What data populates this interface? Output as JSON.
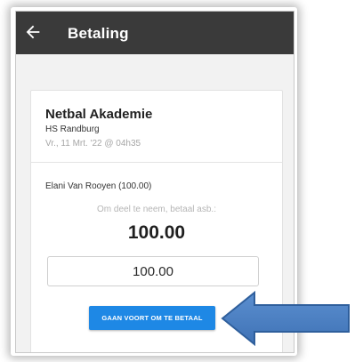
{
  "appbar": {
    "title": "Betaling",
    "back_icon": "arrow-left-icon",
    "background": "#3a3a3a"
  },
  "event": {
    "name": "Netbal Akademie",
    "school": "HS Randburg",
    "date": "Vr., 11 Mrt. '22 @ 04h35"
  },
  "payment": {
    "member_line": "Elani Van Rooyen (100.00)",
    "prompt": "Om deel te neem, betaal asb.:",
    "amount": "100.00",
    "input_value": "100.00",
    "button_label": "GAAN VOORT OM TE BETAAL",
    "button_color": "#1e88e5"
  },
  "annotation": {
    "arrow_icon": "left-pointing-arrow-icon",
    "arrow_color": "#4a7fc1"
  }
}
